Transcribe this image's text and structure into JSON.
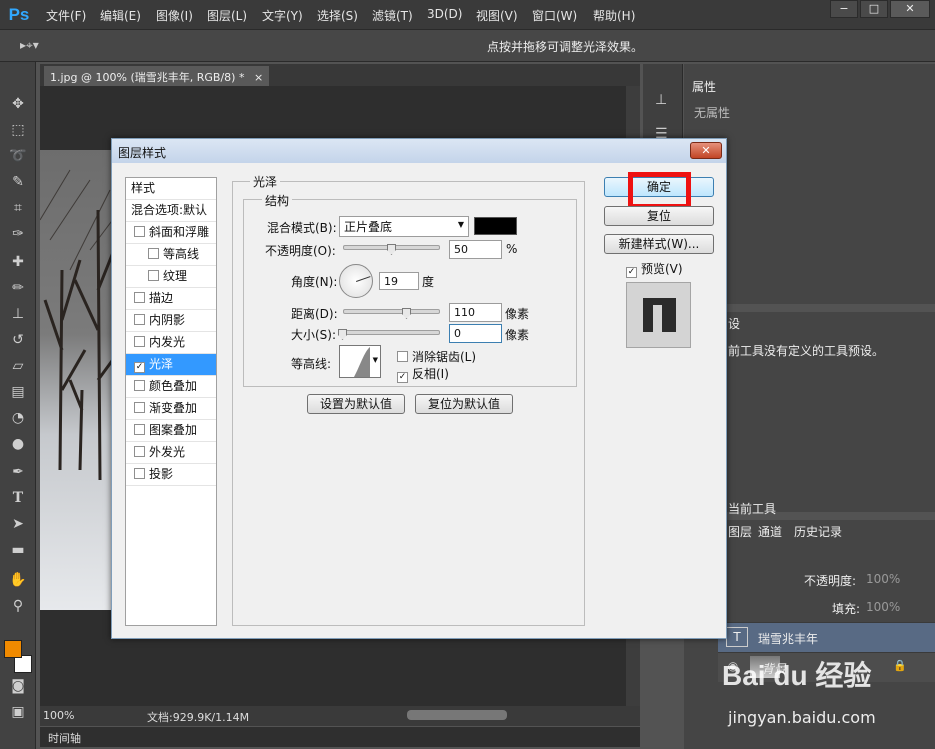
{
  "app": {
    "logo": "Ps"
  },
  "menu": [
    "文件(F)",
    "编辑(E)",
    "图像(I)",
    "图层(L)",
    "文字(Y)",
    "选择(S)",
    "滤镜(T)",
    "3D(D)",
    "视图(V)",
    "窗口(W)",
    "帮助(H)"
  ],
  "window_controls": {
    "minimize": "−",
    "maximize": "□",
    "close": "✕"
  },
  "options_bar": {
    "hint": "点按并拖移可调整光泽效果。"
  },
  "document": {
    "tab": "1.jpg @ 100% (瑞雪兆丰年, RGB/8) *",
    "tab_close": "×"
  },
  "status_bar": {
    "zoom": "100%",
    "doc_info": "文档:929.9K/1.14M"
  },
  "timeline": {
    "label": "时间轴"
  },
  "panels": {
    "properties": {
      "title": "属性",
      "body": "无属性"
    },
    "tool_presets": {
      "tab_fragment": "设",
      "body": "前工具没有定义的工具预设。",
      "footer": "当前工具"
    },
    "layers": {
      "tabs": [
        "图层",
        "通道",
        "历史记录"
      ],
      "opacity_label": "不透明度:",
      "opacity_value": "100%",
      "fill_label": "填充:",
      "fill_value": "100%",
      "items": [
        {
          "name": "瑞雪兆丰年",
          "thumb": "T"
        },
        {
          "name": "背景"
        }
      ]
    }
  },
  "watermark": {
    "line1": "Bai du 经验",
    "line2": "jingyan.baidu.com"
  },
  "dialog": {
    "title": "图层样式",
    "close": "✕",
    "styles_header": "样式",
    "blend_options": "混合选项:默认",
    "style_items": [
      {
        "label": "斜面和浮雕",
        "checked": false,
        "indent": false
      },
      {
        "label": "等高线",
        "checked": false,
        "indent": true
      },
      {
        "label": "纹理",
        "checked": false,
        "indent": true
      },
      {
        "label": "描边",
        "checked": false,
        "indent": false
      },
      {
        "label": "内阴影",
        "checked": false,
        "indent": false
      },
      {
        "label": "内发光",
        "checked": false,
        "indent": false
      },
      {
        "label": "光泽",
        "checked": true,
        "indent": false,
        "selected": true
      },
      {
        "label": "颜色叠加",
        "checked": false,
        "indent": false
      },
      {
        "label": "渐变叠加",
        "checked": false,
        "indent": false
      },
      {
        "label": "图案叠加",
        "checked": false,
        "indent": false
      },
      {
        "label": "外发光",
        "checked": false,
        "indent": false
      },
      {
        "label": "投影",
        "checked": false,
        "indent": false
      }
    ],
    "satin": {
      "group_title": "光泽",
      "structure_title": "结构",
      "blend_mode_label": "混合模式(B):",
      "blend_mode_value": "正片叠底",
      "blend_color": "#000000",
      "opacity_label": "不透明度(O):",
      "opacity_value": "50",
      "opacity_unit": "%",
      "opacity_fraction": 0.5,
      "angle_label": "角度(N):",
      "angle_value": "19",
      "angle_unit": "度",
      "distance_label": "距离(D):",
      "distance_value": "110",
      "distance_unit": "像素",
      "size_label": "大小(S):",
      "size_value": "0",
      "size_unit": "像素",
      "contour_label": "等高线:",
      "anti_alias_label": "消除锯齿(L)",
      "anti_alias_checked": false,
      "invert_label": "反相(I)",
      "invert_checked": true,
      "set_default": "设置为默认值",
      "reset_default": "复位为默认值"
    },
    "buttons": {
      "ok": "确定",
      "reset": "复位",
      "new_style": "新建样式(W)..."
    },
    "preview_label": "预览(V)",
    "preview_checked": true
  },
  "colors": {
    "foreground": "#f08a00",
    "background": "#ffffff",
    "highlight": "#ee1111",
    "selection": "#3399ff"
  }
}
